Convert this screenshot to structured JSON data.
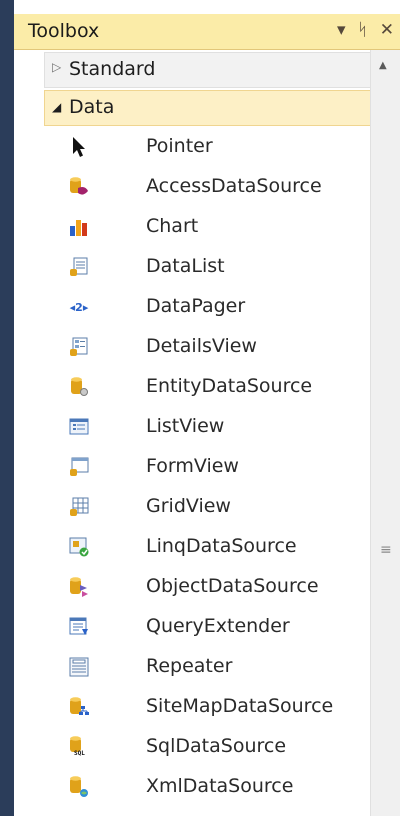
{
  "toolbox": {
    "title": "Toolbox",
    "buttons": {
      "dropdown": "▾",
      "pin": "ᛋ",
      "close": "✕"
    },
    "categories": {
      "standard": {
        "label": "Standard",
        "arrow": "▷"
      },
      "data": {
        "label": "Data",
        "arrow": "◢"
      }
    },
    "items": [
      {
        "label": "Pointer",
        "icon": "pointer-icon"
      },
      {
        "label": "AccessDataSource",
        "icon": "access-datasource-icon"
      },
      {
        "label": "Chart",
        "icon": "chart-icon"
      },
      {
        "label": "DataList",
        "icon": "datalist-icon"
      },
      {
        "label": "DataPager",
        "icon": "datapager-icon"
      },
      {
        "label": "DetailsView",
        "icon": "detailsview-icon"
      },
      {
        "label": "EntityDataSource",
        "icon": "entity-datasource-icon"
      },
      {
        "label": "ListView",
        "icon": "listview-icon"
      },
      {
        "label": "FormView",
        "icon": "formview-icon"
      },
      {
        "label": "GridView",
        "icon": "gridview-icon"
      },
      {
        "label": "LinqDataSource",
        "icon": "linq-datasource-icon"
      },
      {
        "label": "ObjectDataSource",
        "icon": "object-datasource-icon"
      },
      {
        "label": "QueryExtender",
        "icon": "query-extender-icon"
      },
      {
        "label": "Repeater",
        "icon": "repeater-icon"
      },
      {
        "label": "SiteMapDataSource",
        "icon": "sitemap-datasource-icon"
      },
      {
        "label": "SqlDataSource",
        "icon": "sql-datasource-icon"
      },
      {
        "label": "XmlDataSource",
        "icon": "xml-datasource-icon"
      }
    ],
    "icon_text": {
      "datapager": "◂2▸",
      "sql": "SQL"
    },
    "scrollbar": {
      "up_arrow": "▲",
      "grip": "≡"
    },
    "colors": {
      "titlebar": "#fbeca8",
      "frame_edge": "#2b3d5a",
      "selected_category": "#fdf0c6"
    }
  }
}
